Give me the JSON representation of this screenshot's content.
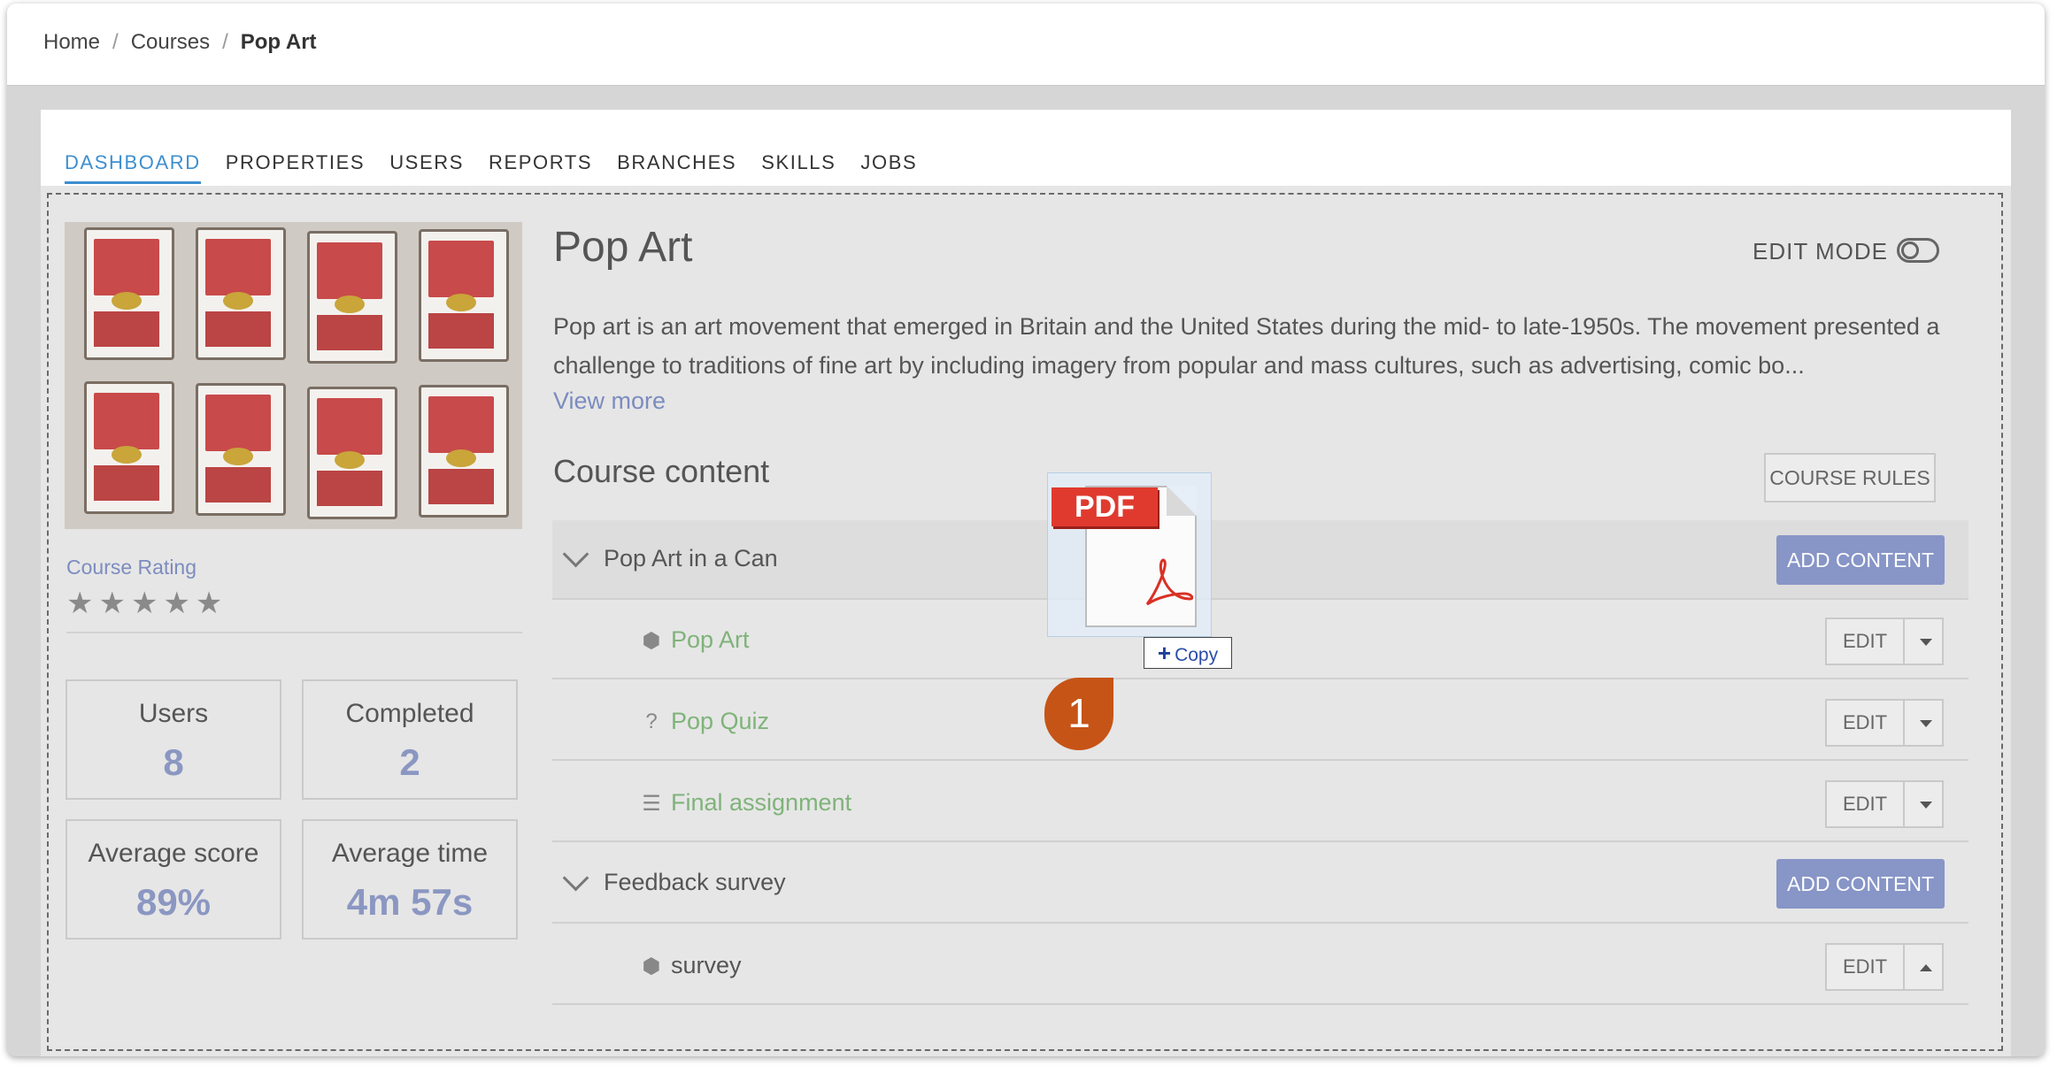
{
  "breadcrumb": {
    "home": "Home",
    "courses": "Courses",
    "current": "Pop Art",
    "sep": "/"
  },
  "tabs": [
    "DASHBOARD",
    "PROPERTIES",
    "USERS",
    "REPORTS",
    "BRANCHES",
    "SKILLS",
    "JOBS"
  ],
  "active_tab": "DASHBOARD",
  "course": {
    "title": "Pop Art",
    "edit_mode_label": "EDIT MODE",
    "edit_mode_on": false,
    "description": "Pop art is an art movement that emerged in Britain and the United States during the mid- to late-1950s. The movement presented a challenge to traditions of fine art by including imagery from popular and mass cultures, such as advertising, comic bo...",
    "view_more": "View more"
  },
  "sidebar": {
    "rating_label": "Course Rating",
    "stars": "★★★★★",
    "rating_value": 0,
    "stats": {
      "users": {
        "label": "Users",
        "value": "8"
      },
      "completed": {
        "label": "Completed",
        "value": "2"
      },
      "avg_score": {
        "label": "Average score",
        "value": "89%"
      },
      "avg_time": {
        "label": "Average time",
        "value": "4m 57s"
      }
    }
  },
  "content": {
    "heading": "Course content",
    "rules_button": "COURSE RULES",
    "add_content": "ADD CONTENT",
    "edit": "EDIT",
    "units": [
      {
        "name": "Pop Art in a Can"
      },
      {
        "name": "Feedback survey"
      }
    ],
    "items": [
      {
        "name": "Pop Art",
        "icon": "cube-icon"
      },
      {
        "name": "Pop Quiz",
        "icon": "question-circle-icon"
      },
      {
        "name": "Final assignment",
        "icon": "list-icon"
      },
      {
        "name": "survey",
        "icon": "cube-icon"
      }
    ]
  },
  "drag": {
    "file_badge": "PDF",
    "copy_label": "Copy",
    "step_number": "1"
  },
  "colors": {
    "accent": "#3d8fd0",
    "primary_button": "#8795c7",
    "item_link": "#7fb37a",
    "pdf_red": "#e03a2f",
    "marker": "#c65416"
  }
}
